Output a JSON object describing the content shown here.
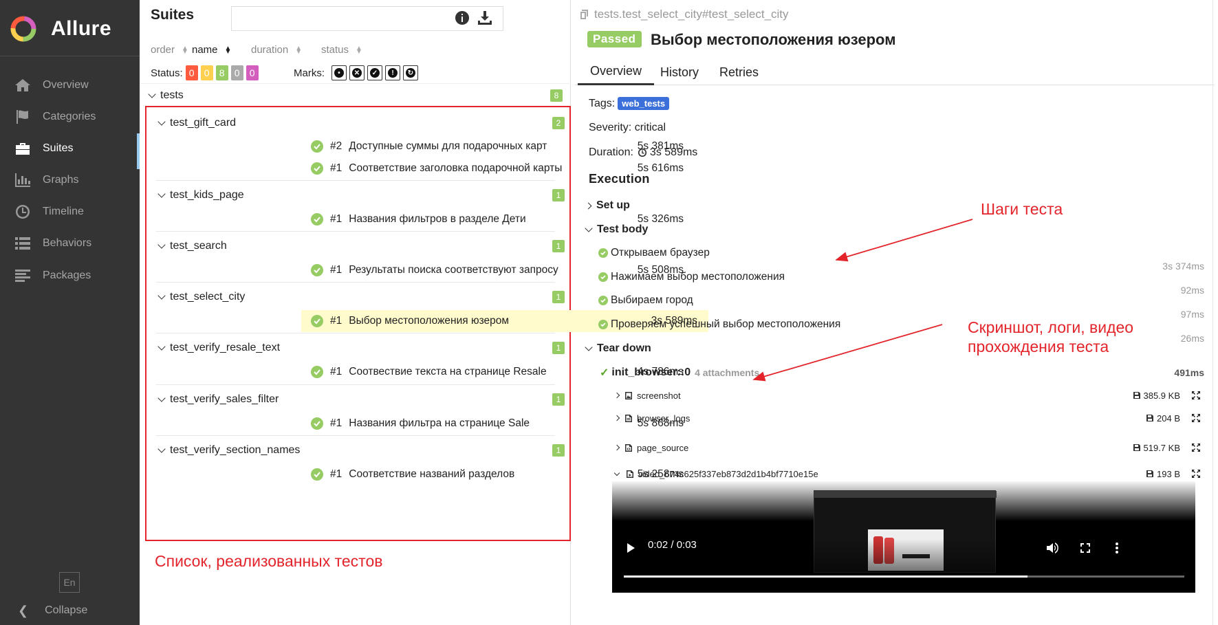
{
  "sidebar": {
    "brand": "Allure",
    "items": [
      {
        "label": "Overview",
        "icon": "home-icon"
      },
      {
        "label": "Categories",
        "icon": "flag-icon"
      },
      {
        "label": "Suites",
        "icon": "briefcase-icon"
      },
      {
        "label": "Graphs",
        "icon": "bar-chart-icon"
      },
      {
        "label": "Timeline",
        "icon": "clock-icon"
      },
      {
        "label": "Behaviors",
        "icon": "list-icon"
      },
      {
        "label": "Packages",
        "icon": "align-left-icon"
      }
    ],
    "active": "Suites",
    "lang": "En",
    "collapse": "Collapse",
    "accent": "#97cbf0"
  },
  "suites": {
    "title": "Suites",
    "search_value": "",
    "sort": {
      "order": "order",
      "name": "name",
      "duration": "duration",
      "status": "status"
    },
    "status_label": "Status:",
    "status_counts": [
      {
        "value": "0",
        "color": "#fd5a3e"
      },
      {
        "value": "0",
        "color": "#ffd050"
      },
      {
        "value": "8",
        "color": "#97cc64"
      },
      {
        "value": "0",
        "color": "#aaaaaa"
      },
      {
        "value": "0",
        "color": "#d35ebe"
      }
    ],
    "marks_label": "Marks:",
    "root": {
      "name": "tests",
      "count": "8"
    },
    "groups": [
      {
        "name": "test_gift_card",
        "count": "2",
        "cases": [
          {
            "num": "#2",
            "name": "Доступные суммы для подарочных карт",
            "duration": "5s 381ms"
          },
          {
            "num": "#1",
            "name": "Соответствие заголовка подарочной карты",
            "duration": "5s 616ms"
          }
        ]
      },
      {
        "name": "test_kids_page",
        "count": "1",
        "cases": [
          {
            "num": "#1",
            "name": "Названия фильтров в разделе Дети",
            "duration": "5s 326ms"
          }
        ]
      },
      {
        "name": "test_search",
        "count": "1",
        "cases": [
          {
            "num": "#1",
            "name": "Результаты поиска соответствуют запросу",
            "duration": "5s 508ms"
          }
        ]
      },
      {
        "name": "test_select_city",
        "count": "1",
        "cases": [
          {
            "num": "#1",
            "name": "Выбор местоположения юзером",
            "duration": "3s 589ms"
          }
        ]
      },
      {
        "name": "test_verify_resale_text",
        "count": "1",
        "cases": [
          {
            "num": "#1",
            "name": "Соотвествие текста на странице Resale",
            "duration": "4s 786ms"
          }
        ]
      },
      {
        "name": "test_verify_sales_filter",
        "count": "1",
        "cases": [
          {
            "num": "#1",
            "name": "Названия фильтра на странице Sale",
            "duration": "5s 868ms"
          }
        ]
      },
      {
        "name": "test_verify_section_names",
        "count": "1",
        "cases": [
          {
            "num": "#1",
            "name": "Соответствие названий разделов",
            "duration": "5s 258ms"
          }
        ]
      }
    ],
    "annotation": "Список, реализованных тестов"
  },
  "detail": {
    "crumb": "tests.test_select_city#test_select_city",
    "status": "Passed",
    "title": "Выбор местоположения юзером",
    "tabs": [
      "Overview",
      "History",
      "Retries"
    ],
    "tags_label": "Tags:",
    "tag": "web_tests",
    "severity": "Severity: critical",
    "duration_label": "Duration:",
    "duration": "3s 589ms",
    "execution": "Execution",
    "setup": "Set up",
    "body": "Test body",
    "steps": [
      {
        "name": "Открываем браузер",
        "time": "3s 374ms"
      },
      {
        "name": "Нажимаем выбор местоположения",
        "time": "92ms"
      },
      {
        "name": "Выбираем город",
        "time": "97ms"
      },
      {
        "name": "Проверяем успешный выбор местоположения",
        "time": "26ms"
      }
    ],
    "teardown": "Tear down",
    "init": {
      "name": "init_browser::0",
      "attachments": "4 attachments",
      "time": "491ms"
    },
    "attachments": [
      {
        "name": "screenshot",
        "size": "385.9 KB"
      },
      {
        "name": "browser_logs",
        "size": "204 B"
      },
      {
        "name": "page_source",
        "size": "519.7 KB"
      },
      {
        "name": "video_674c625f337eb873d2d1b4bf7710e15e",
        "size": "193 B"
      }
    ],
    "video": {
      "time": "0:02 / 0:03",
      "progress": 0.72
    },
    "annot_steps": "Шаги теста",
    "annot_attach_1": "Скриншот, логи, видео",
    "annot_attach_2": "прохождения теста"
  }
}
